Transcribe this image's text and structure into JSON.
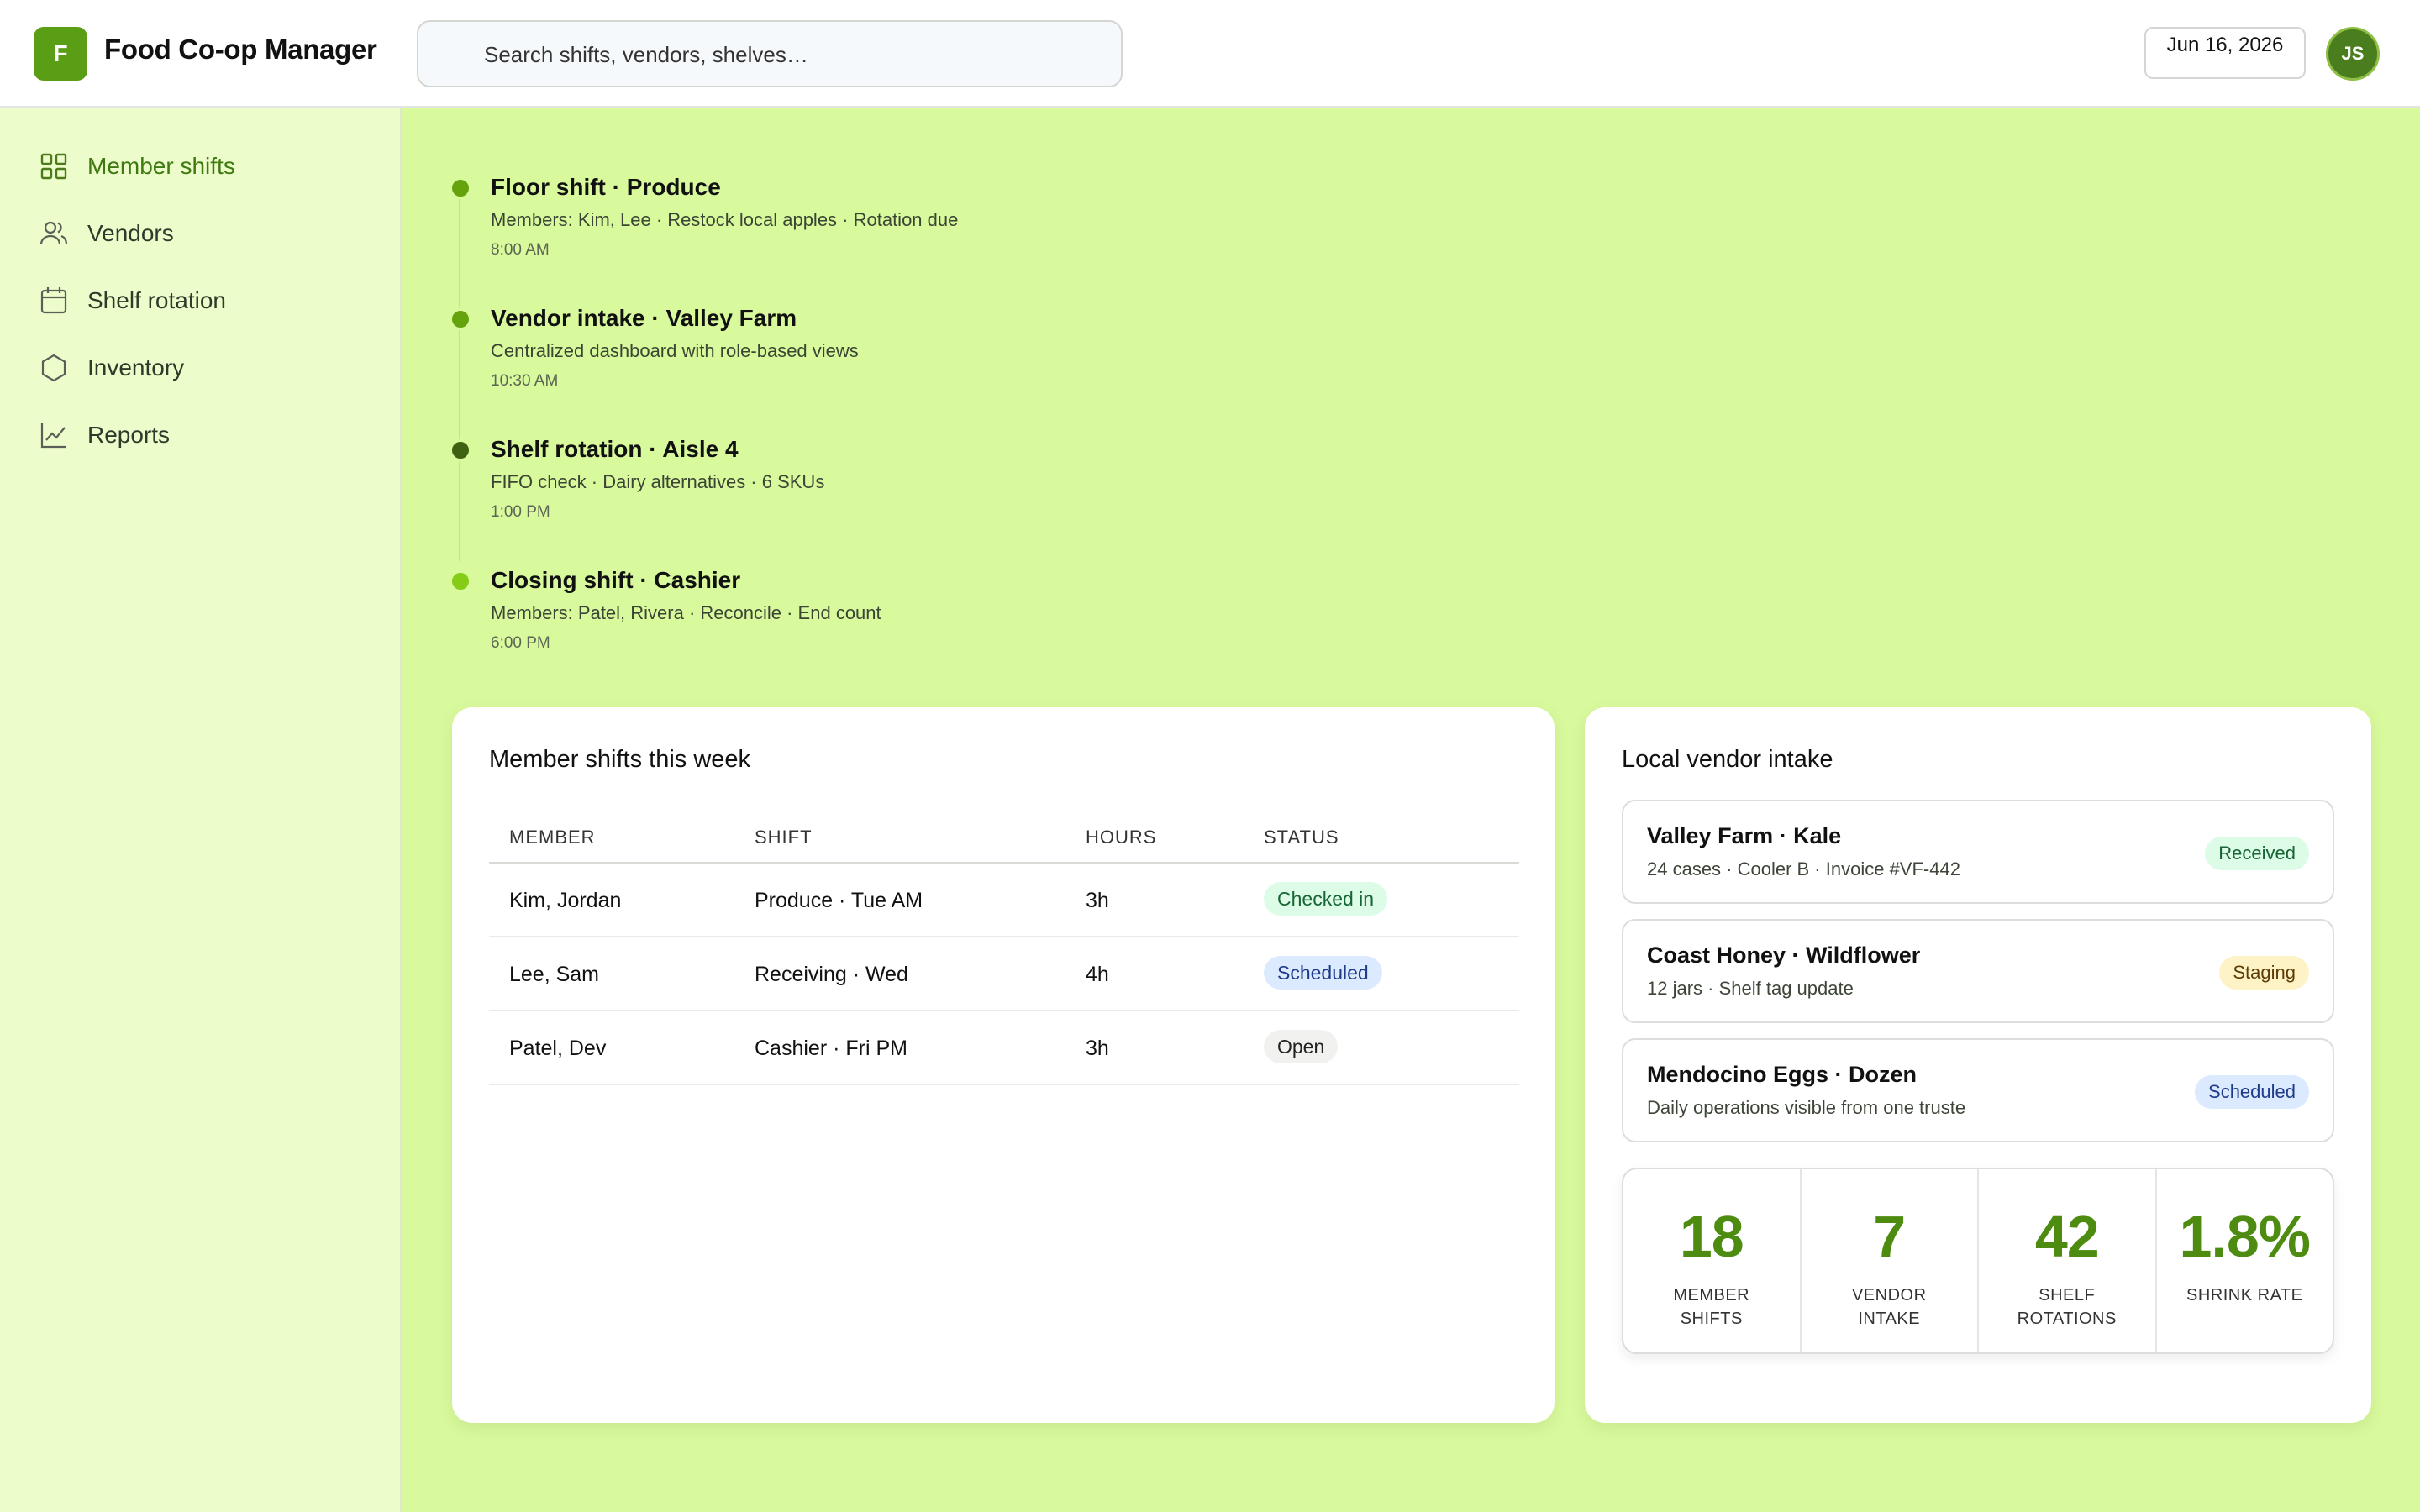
{
  "app": {
    "logo_letter": "F",
    "title": "Food Co-op Manager"
  },
  "search": {
    "placeholder": "Search shifts, vendors, shelves…",
    "icon": "search-icon"
  },
  "header": {
    "date": "Jun 16, 2026",
    "avatar_initials": "JS"
  },
  "colors": {
    "brand": "#5a9e15",
    "page_bg": "#d9f99d",
    "sidebar_bg": "#ecfccb",
    "stat_value": "#4d8c10"
  },
  "sidebar": {
    "items": [
      {
        "label": "Member shifts",
        "icon": "grid-icon",
        "active": true
      },
      {
        "label": "Vendors",
        "icon": "users-icon",
        "active": false
      },
      {
        "label": "Shelf rotation",
        "icon": "calendar-icon",
        "active": false
      },
      {
        "label": "Inventory",
        "icon": "hexagon-icon",
        "active": false
      },
      {
        "label": "Reports",
        "icon": "chart-line-icon",
        "active": false
      }
    ]
  },
  "timeline": [
    {
      "title": "Floor shift · Produce",
      "desc": "Members: Kim, Lee · Restock local apples · Rotation due",
      "time": "8:00 AM",
      "dot_color": "#65a30d"
    },
    {
      "title": "Vendor intake · Valley Farm",
      "desc": "Centralized dashboard with role-based views",
      "time": "10:30 AM",
      "dot_color": "#65a30d"
    },
    {
      "title": "Shelf rotation · Aisle 4",
      "desc": "FIFO check · Dairy alternatives · 6 SKUs",
      "time": "1:00 PM",
      "dot_color": "#3f6212"
    },
    {
      "title": "Closing shift · Cashier",
      "desc": "Members: Patel, Rivera · Reconcile · End count",
      "time": "6:00 PM",
      "dot_color": "#84cc16"
    }
  ],
  "shifts_card": {
    "title": "Member shifts this week",
    "columns": [
      "MEMBER",
      "SHIFT",
      "HOURS",
      "STATUS"
    ],
    "rows": [
      {
        "member": "Kim, Jordan",
        "shift": "Produce · Tue AM",
        "hours": "3h",
        "status": "Checked in"
      },
      {
        "member": "Lee, Sam",
        "shift": "Receiving · Wed",
        "hours": "4h",
        "status": "Scheduled"
      },
      {
        "member": "Patel, Dev",
        "shift": "Cashier · Fri PM",
        "hours": "3h",
        "status": "Open"
      }
    ]
  },
  "vendor_card": {
    "title": "Local vendor intake",
    "items": [
      {
        "name": "Valley Farm · Kale",
        "sub": "24 cases · Cooler B · Invoice #VF-442",
        "badge": "Received"
      },
      {
        "name": "Coast Honey · Wildflower",
        "sub": "12 jars · Shelf tag update",
        "badge": "Staging"
      },
      {
        "name": "Mendocino Eggs · Dozen",
        "sub": "Daily operations visible from one truste",
        "badge": "Scheduled"
      }
    ],
    "stats": [
      {
        "value": "18",
        "label_line1": "MEMBER",
        "label_line2": "SHIFTS"
      },
      {
        "value": "7",
        "label_line1": "VENDOR",
        "label_line2": "INTAKE"
      },
      {
        "value": "42",
        "label_line1": "SHELF",
        "label_line2": "ROTATIONS"
      },
      {
        "value": "1.8%",
        "label_line1": "SHRINK RATE",
        "label_line2": ""
      }
    ]
  }
}
